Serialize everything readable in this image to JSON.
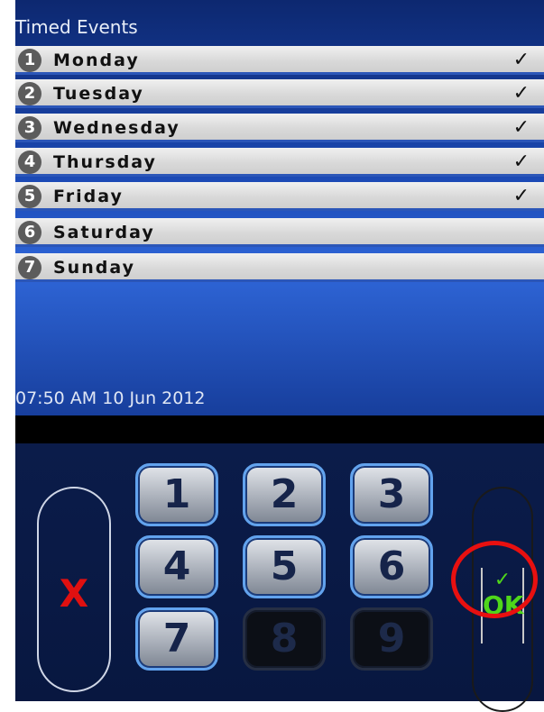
{
  "screen": {
    "title": "Timed Events",
    "days": [
      {
        "num": "1",
        "label": "Monday",
        "checked": true
      },
      {
        "num": "2",
        "label": "Tuesday",
        "checked": true
      },
      {
        "num": "3",
        "label": "Wednesday",
        "checked": true
      },
      {
        "num": "4",
        "label": "Thursday",
        "checked": true
      },
      {
        "num": "5",
        "label": "Friday",
        "checked": true
      },
      {
        "num": "6",
        "label": "Saturday",
        "checked": false
      },
      {
        "num": "7",
        "label": "Sunday",
        "checked": false
      }
    ],
    "check_symbol": "✓",
    "datetime": "07:50 AM 10 Jun 2012"
  },
  "keypad": {
    "keys": [
      "1",
      "2",
      "3",
      "4",
      "5",
      "6",
      "7",
      "8",
      "9"
    ],
    "disabled_keys": [
      "8",
      "9"
    ],
    "cancel_label": "X",
    "ok_check": "✓",
    "ok_label": "OK"
  },
  "colors": {
    "cancel": "#e01010",
    "ok": "#4fd61a",
    "highlight_ring": "#e81010",
    "key_border": "#62a3ee"
  }
}
